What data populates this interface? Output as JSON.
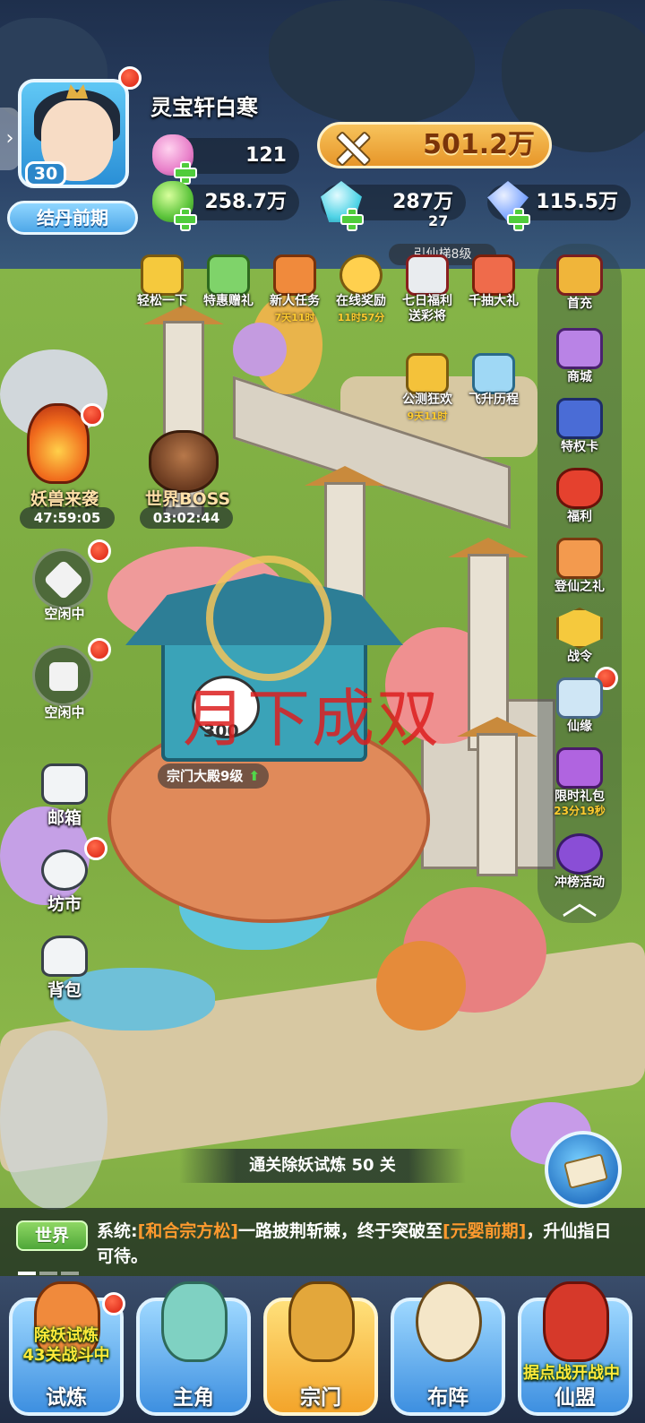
{
  "player": {
    "name": "灵宝轩白寒",
    "level": "30",
    "realm": "结丹前期"
  },
  "resources": {
    "stamina": "121",
    "power": "501.2万",
    "green_jade": "258.7万",
    "cyan_crystal": "287万",
    "cyan_crystal_badge": "27",
    "blue_gem": "115.5万"
  },
  "events_top": [
    {
      "label": "轻松一下",
      "sub": ""
    },
    {
      "label": "特惠赠礼",
      "sub": ""
    },
    {
      "label": "新人任务",
      "sub": "7天11时"
    },
    {
      "label": "在线奖励",
      "sub": "11时57分"
    },
    {
      "label": "七日福利\n送彩将",
      "sub": ""
    },
    {
      "label": "千抽大礼",
      "sub": ""
    }
  ],
  "gate_label": "引仙梯8级",
  "mid_events": [
    {
      "label": "公测狂欢",
      "sub": "9天11时"
    },
    {
      "label": "飞升历程",
      "sub": ""
    }
  ],
  "right_menu": [
    {
      "label": "首充",
      "sub": ""
    },
    {
      "label": "商城",
      "sub": ""
    },
    {
      "label": "特权卡",
      "sub": ""
    },
    {
      "label": "福利",
      "sub": ""
    },
    {
      "label": "登仙之礼",
      "sub": ""
    },
    {
      "label": "战令",
      "sub": ""
    },
    {
      "label": "仙缘",
      "sub": ""
    },
    {
      "label": "限时礼包",
      "sub": "23分19秒"
    },
    {
      "label": "冲榜活动",
      "sub": ""
    }
  ],
  "left_events": {
    "monster": {
      "label": "妖兽来袭",
      "timer": "47:59:05"
    },
    "boss": {
      "label": "世界BOSS",
      "timer": "03:02:44"
    },
    "idle1": "空闲中",
    "idle2": "空闲中",
    "mail": "邮箱",
    "market": "坊市",
    "bag": "背包"
  },
  "hall": {
    "level": "宗门大殿9级",
    "bubble_value": "300"
  },
  "watermark": "月下成双",
  "quest_banner": "通关除妖试炼 50 关",
  "chat": {
    "channel": "世界",
    "prefix": "系统:",
    "name": "[和合宗方松]",
    "middle": "一路披荆斩棘，终于突破至",
    "realm": "[元婴前期]",
    "suffix": "，升仙指日可待。"
  },
  "bottom_nav": [
    {
      "label": "试炼",
      "promo": "除妖试炼\n43关战斗中"
    },
    {
      "label": "主角",
      "promo": ""
    },
    {
      "label": "宗门",
      "promo": ""
    },
    {
      "label": "布阵",
      "promo": ""
    },
    {
      "label": "仙盟",
      "promo": "据点战开战中"
    }
  ],
  "colors": {
    "reddot": "#d91f10",
    "power_gold": "#e79629",
    "highlight_orange": "#ff9a2e",
    "timer_yellow": "#ffcb2e"
  }
}
